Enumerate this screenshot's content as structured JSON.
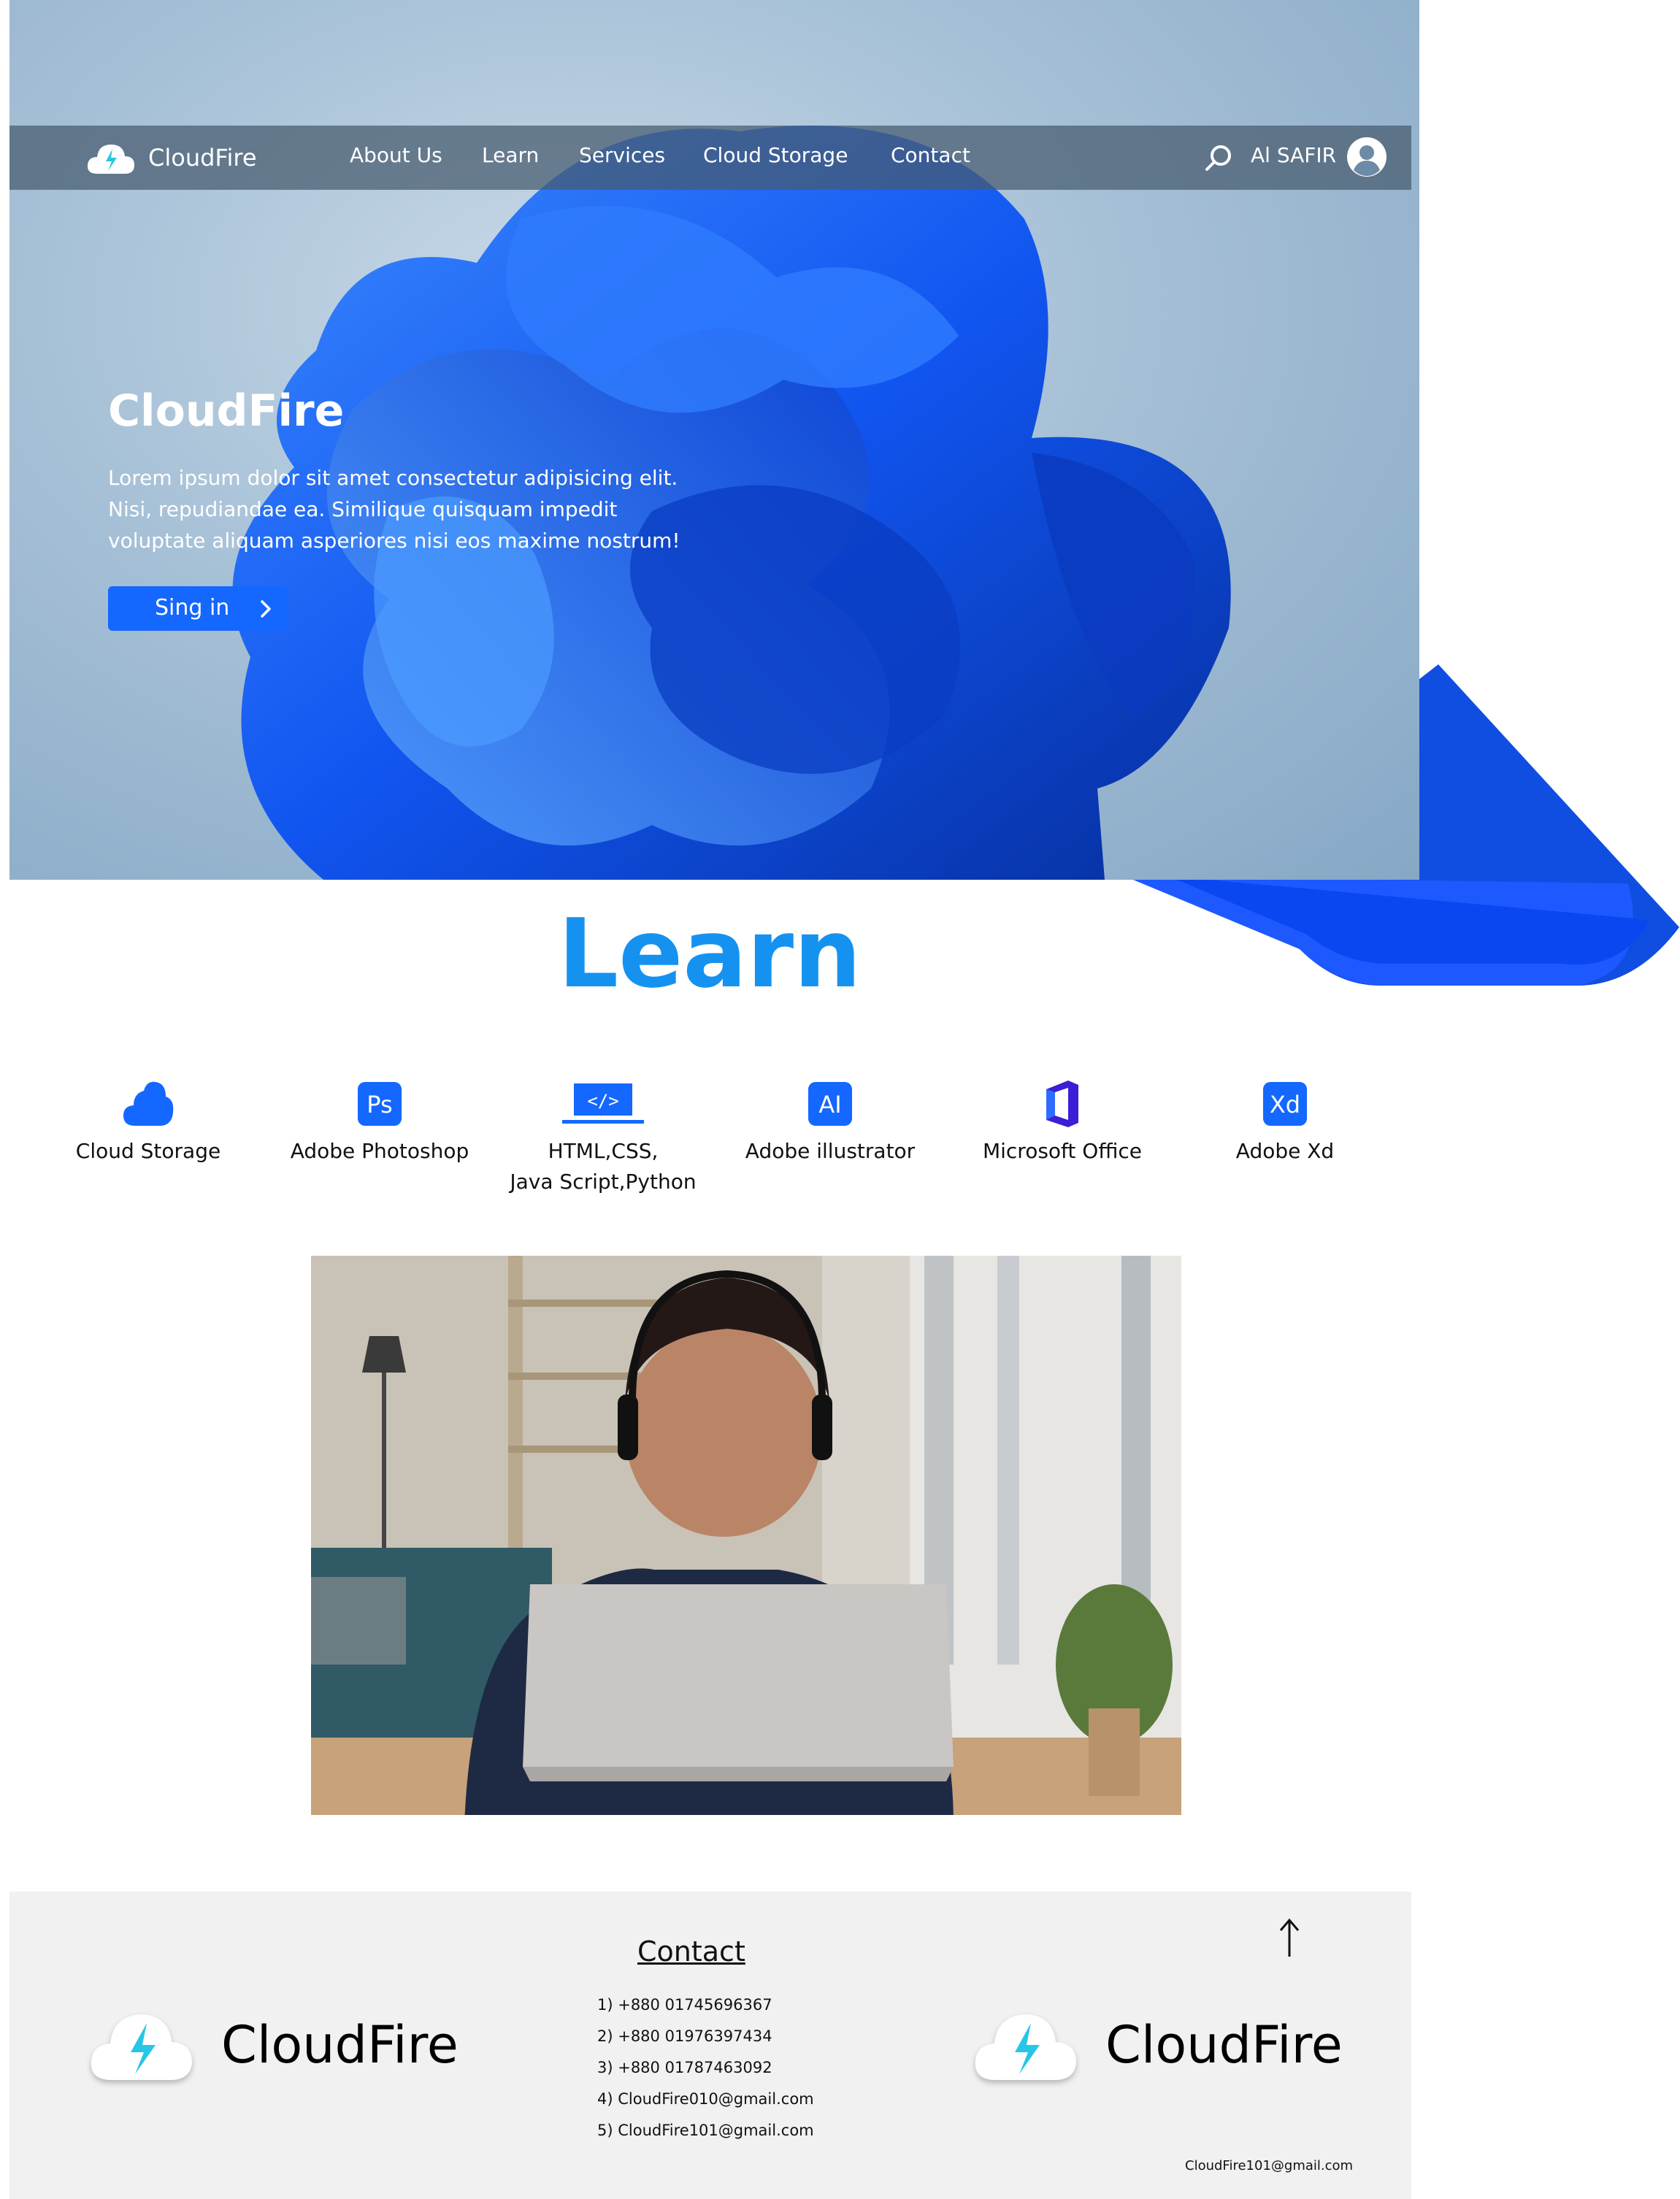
{
  "brand": {
    "name": "CloudFire"
  },
  "nav": {
    "links": [
      "About Us",
      "Learn",
      "Services",
      "Cloud Storage",
      "Contact"
    ],
    "user_name": "Al SAFIR"
  },
  "hero": {
    "title": "CloudFire",
    "lines": [
      "Lorem ipsum dolor sit amet consectetur adipisicing elit.",
      "Nisi, repudiandae ea. Similique quisquam impedit",
      "voluptate aliquam asperiores nisi eos maxime nostrum!"
    ],
    "button_label": "Sing in"
  },
  "learn": {
    "title": "Learn",
    "skills": [
      {
        "label": "Cloud Storage",
        "icon": "cloud-icon"
      },
      {
        "label": "Adobe Photoshop",
        "icon": "photoshop-icon",
        "badge": "Ps"
      },
      {
        "label": "HTML,CSS,",
        "label2": "Java Script,Python",
        "icon": "code-icon",
        "badge": "</>"
      },
      {
        "label": "Adobe illustrator",
        "icon": "illustrator-icon",
        "badge": "AI"
      },
      {
        "label": "Microsoft Office",
        "icon": "office-icon"
      },
      {
        "label": "Adobe Xd",
        "icon": "xd-icon",
        "badge": "Xd"
      }
    ]
  },
  "footer": {
    "brand_left": "CloudFire",
    "brand_right": "CloudFire",
    "contact_heading": "Contact",
    "contacts": [
      "1) +880 01745696367",
      "2) +880 01976397434",
      "3) +880 01787463092",
      "4) CloudFire010@gmail.com",
      "5) CloudFire101@gmail.com"
    ],
    "email": "CloudFire101@gmail.com"
  },
  "colors": {
    "accent": "#1467ff",
    "learn_title": "#1592f0",
    "footer_bg": "#f1f1f1",
    "bolt": "#27c6e6"
  }
}
